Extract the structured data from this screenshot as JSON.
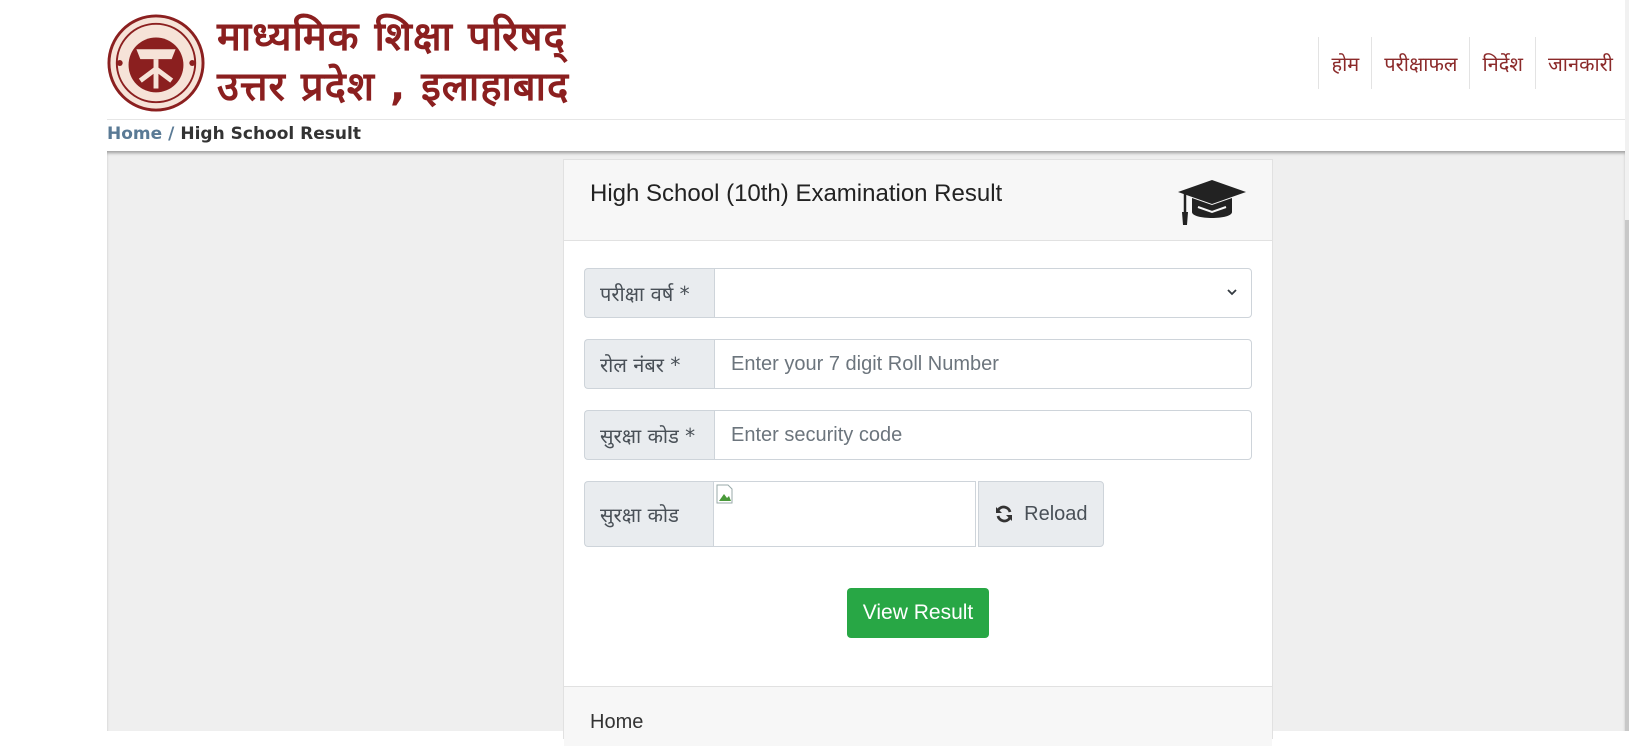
{
  "header": {
    "logo_line1": "माध्यमिक शिक्षा परिषद्",
    "logo_line2": "उत्तर प्रदेश , इलाहाबाद",
    "emblem_text": "उत्तर प्रदेश",
    "brand_color": "#8b1f1f",
    "nav": [
      {
        "label": "होम"
      },
      {
        "label": "परीक्षाफल"
      },
      {
        "label": "निर्देश"
      },
      {
        "label": "जानकारी"
      }
    ]
  },
  "breadcrumb": {
    "home": "Home",
    "separator": "/",
    "current": "High School Result"
  },
  "card": {
    "title": "High School (10th) Examination Result",
    "icon": "graduation-cap-icon",
    "form": {
      "year_label": "परीक्षा वर्ष *",
      "year_value": "",
      "roll_label": "रोल नंबर *",
      "roll_placeholder": "Enter your 7 digit Roll Number",
      "roll_value": "",
      "code_label": "सुरक्षा कोड *",
      "code_placeholder": "Enter security code",
      "code_value": "",
      "captcha_label": "सुरक्षा कोड",
      "reload_label": "Reload",
      "submit_label": "View Result",
      "submit_color": "#28a745"
    },
    "footer_link": "Home"
  }
}
